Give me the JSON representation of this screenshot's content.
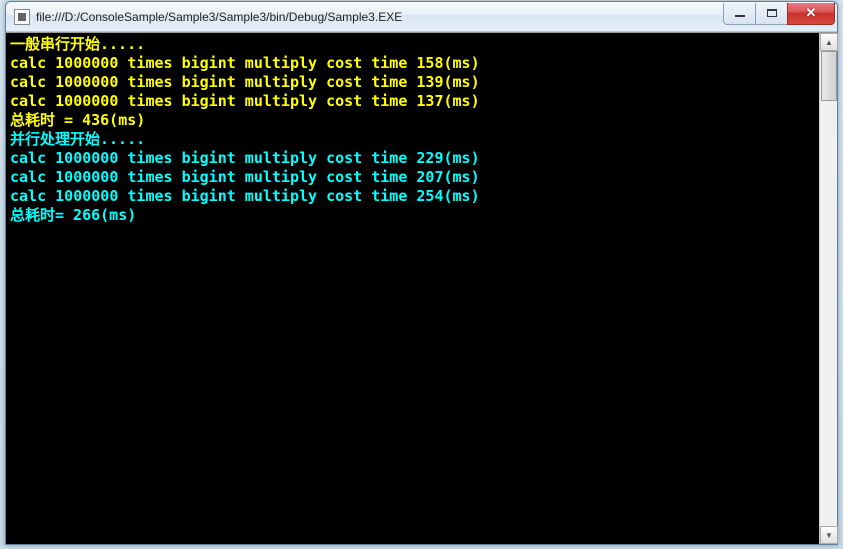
{
  "window": {
    "title": "file:///D:/ConsoleSample/Sample3/Sample3/bin/Debug/Sample3.EXE"
  },
  "console": {
    "section1": {
      "header": "一般串行开始.....",
      "lines": [
        "calc 1000000 times bigint multiply cost time 158(ms)",
        "calc 1000000 times bigint multiply cost time 139(ms)",
        "calc 1000000 times bigint multiply cost time 137(ms)"
      ],
      "total": "总耗时 = 436(ms)"
    },
    "section2": {
      "header": "并行处理开始.....",
      "lines": [
        "calc 1000000 times bigint multiply cost time 229(ms)",
        "calc 1000000 times bigint multiply cost time 207(ms)",
        "calc 1000000 times bigint multiply cost time 254(ms)"
      ],
      "total": "总耗时= 266(ms)"
    }
  }
}
